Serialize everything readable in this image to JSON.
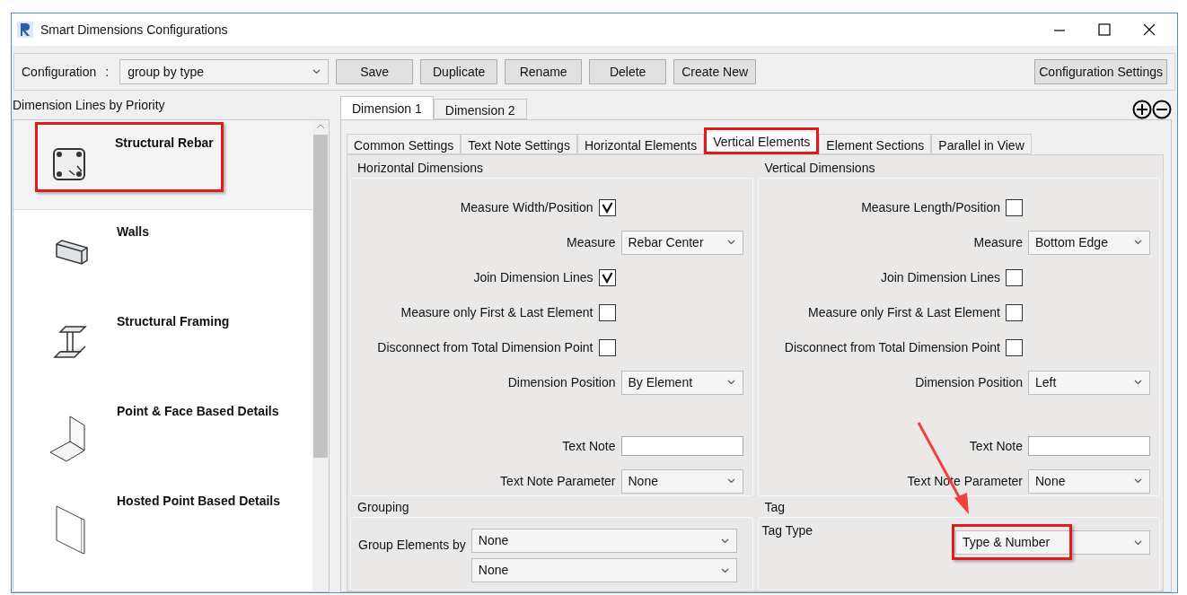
{
  "window": {
    "title": "Smart Dimensions Configurations"
  },
  "toolbar": {
    "label": "Configuration",
    "separator": ":",
    "configuration": "group by type",
    "buttons": [
      "Save",
      "Duplicate",
      "Rename",
      "Delete",
      "Create New"
    ],
    "settings_button": "Configuration Settings"
  },
  "sidebar": {
    "title": "Dimension Lines by Priority",
    "items": [
      {
        "label": "Structural Rebar",
        "kind": "rebar",
        "selected": true,
        "highlighted": true
      },
      {
        "label": "Walls",
        "kind": "wall",
        "selected": false,
        "highlighted": false
      },
      {
        "label": "Structural Framing",
        "kind": "framing",
        "selected": false,
        "highlighted": false
      },
      {
        "label": "Point & Face Based Details",
        "kind": "corner",
        "selected": false,
        "highlighted": false
      },
      {
        "label": "Hosted Point Based Details",
        "kind": "plate",
        "selected": false,
        "highlighted": false
      }
    ]
  },
  "dimension_tabs": [
    {
      "label": "Dimension 1",
      "selected": true
    },
    {
      "label": "Dimension 2",
      "selected": false
    }
  ],
  "tabs": [
    {
      "label": "Common Settings",
      "selected": false,
      "highlighted": false
    },
    {
      "label": "Text Note Settings",
      "selected": false,
      "highlighted": false
    },
    {
      "label": "Horizontal Elements",
      "selected": false,
      "highlighted": false
    },
    {
      "label": "Vertical Elements",
      "selected": true,
      "highlighted": true
    },
    {
      "label": "Element Sections",
      "selected": false,
      "highlighted": false
    },
    {
      "label": "Parallel in View",
      "selected": false,
      "highlighted": false
    }
  ],
  "groups": [
    {
      "title": "Horizontal Dimensions",
      "fields": [
        {
          "kind": "checkbox",
          "label": "Measure Width/Position",
          "checked": true
        },
        {
          "kind": "dropdown",
          "label": "Measure",
          "value": "Rebar Center"
        },
        {
          "kind": "checkbox",
          "label": "Join Dimension Lines",
          "checked": true
        },
        {
          "kind": "checkbox",
          "label": "Measure only First & Last Element",
          "checked": false
        },
        {
          "kind": "checkbox",
          "label": "Disconnect from Total Dimension Point",
          "checked": false
        },
        {
          "kind": "dropdown",
          "label": "Dimension Position",
          "value": "By Element"
        },
        {
          "kind": "text",
          "label": "Text Note"
        },
        {
          "kind": "dropdown",
          "label": "Text Note Parameter",
          "value": "None"
        }
      ]
    },
    {
      "title": "Vertical Dimensions",
      "fields": [
        {
          "kind": "checkbox",
          "label": "Measure Length/Position",
          "checked": false
        },
        {
          "kind": "dropdown",
          "label": "Measure",
          "value": "Bottom Edge"
        },
        {
          "kind": "checkbox",
          "label": "Join Dimension Lines",
          "checked": false
        },
        {
          "kind": "checkbox",
          "label": "Measure only First & Last Element",
          "checked": false
        },
        {
          "kind": "checkbox",
          "label": "Disconnect from Total Dimension Point",
          "checked": false
        },
        {
          "kind": "dropdown",
          "label": "Dimension Position",
          "value": "Left"
        },
        {
          "kind": "text",
          "label": "Text Note"
        },
        {
          "kind": "dropdown",
          "label": "Text Note Parameter",
          "value": "None"
        }
      ]
    }
  ],
  "grouping": {
    "title": "Grouping",
    "label": "Group Elements by",
    "values": [
      "None",
      "None"
    ]
  },
  "tag": {
    "title": "Tag",
    "label": "Tag Type",
    "value": "Type & Number",
    "highlighted": true
  },
  "annotations": [
    {
      "kind": "arrow"
    }
  ]
}
